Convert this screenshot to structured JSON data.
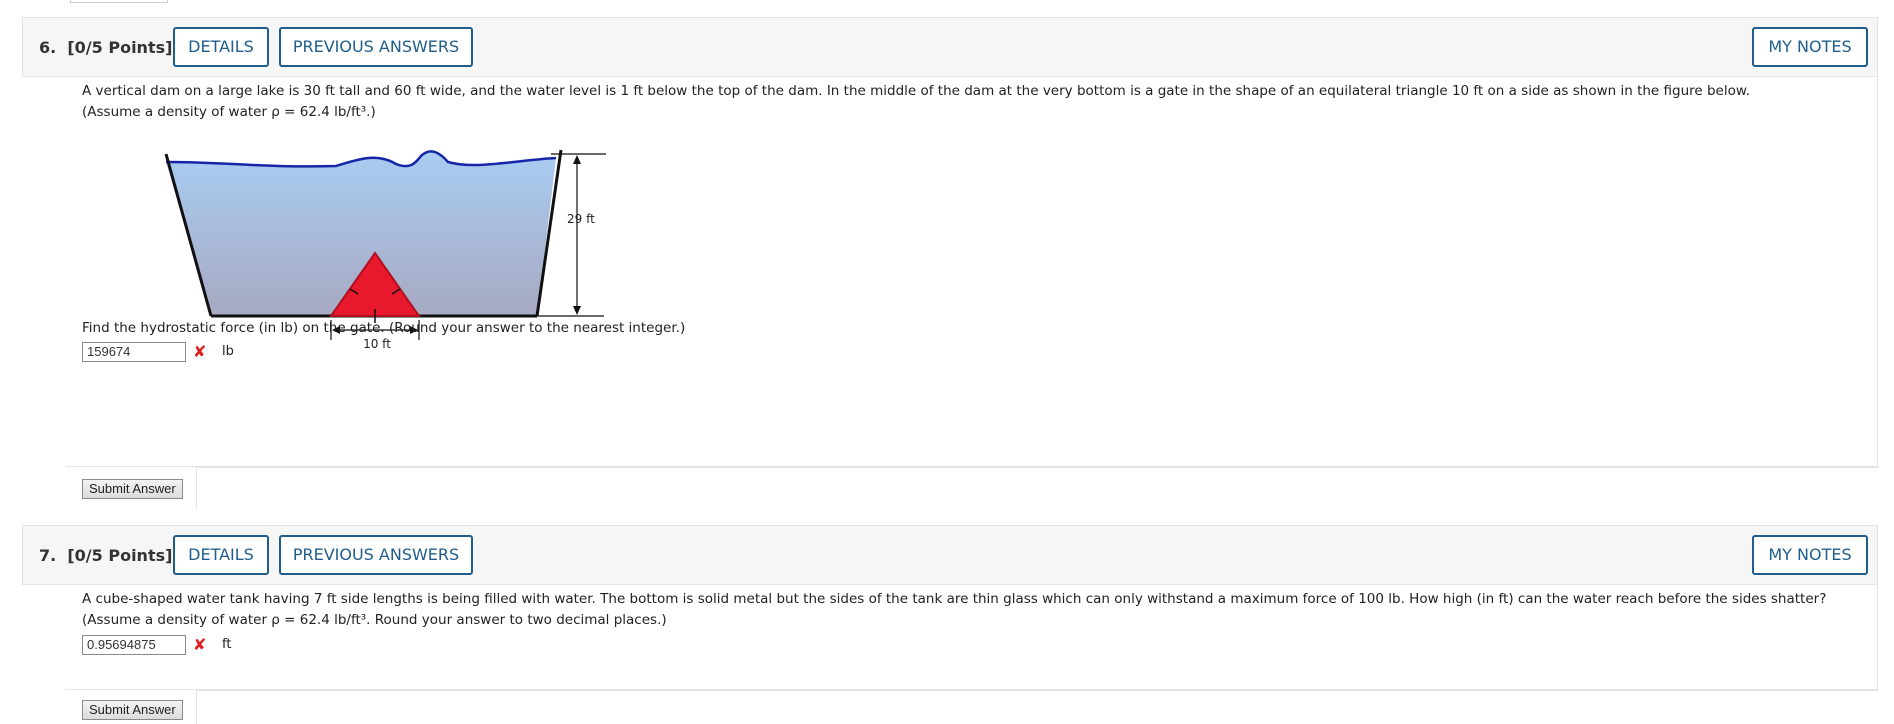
{
  "questions": [
    {
      "number": "6.",
      "points": "[0/5 Points]",
      "details_label": "DETAILS",
      "prev_answers_label": "PREVIOUS ANSWERS",
      "my_notes_label": "MY NOTES",
      "text_line1": "A vertical dam on a large lake is 30 ft tall and 60 ft wide, and the water level is 1 ft below the top of the dam. In the middle of the dam at the very bottom is a gate in the shape of an equilateral triangle 10 ft on a side as shown in the figure below.",
      "text_line2": "(Assume a density of water ρ = 62.4 lb/ft³.)",
      "figure": {
        "height_label": "29 ft",
        "width_label": "10 ft",
        "water_color": "#a9cdf2",
        "gate_color": "#e8192c"
      },
      "prompt": "Find the hydrostatic force (in lb) on the gate. (Round your answer to the nearest integer.)",
      "answer_value": "159674",
      "answer_unit": "lb",
      "status": "incorrect",
      "submit_label": "Submit Answer"
    },
    {
      "number": "7.",
      "points": "[0/5 Points]",
      "details_label": "DETAILS",
      "prev_answers_label": "PREVIOUS ANSWERS",
      "my_notes_label": "MY NOTES",
      "text_line1": "A cube-shaped water tank having 7 ft side lengths is being filled with water. The bottom is solid metal but the sides of the tank are thin glass which can only withstand a maximum force of 100 lb. How high (in ft) can the water reach before the sides shatter?",
      "text_line2": "(Assume a density of water ρ = 62.4 lb/ft³. Round your answer to two decimal places.)",
      "answer_value": "0.95694875",
      "answer_unit": "ft",
      "status": "incorrect",
      "submit_label": "Submit Answer"
    }
  ],
  "colors": {
    "accent": "#1e5d8c",
    "error": "#e02020"
  }
}
